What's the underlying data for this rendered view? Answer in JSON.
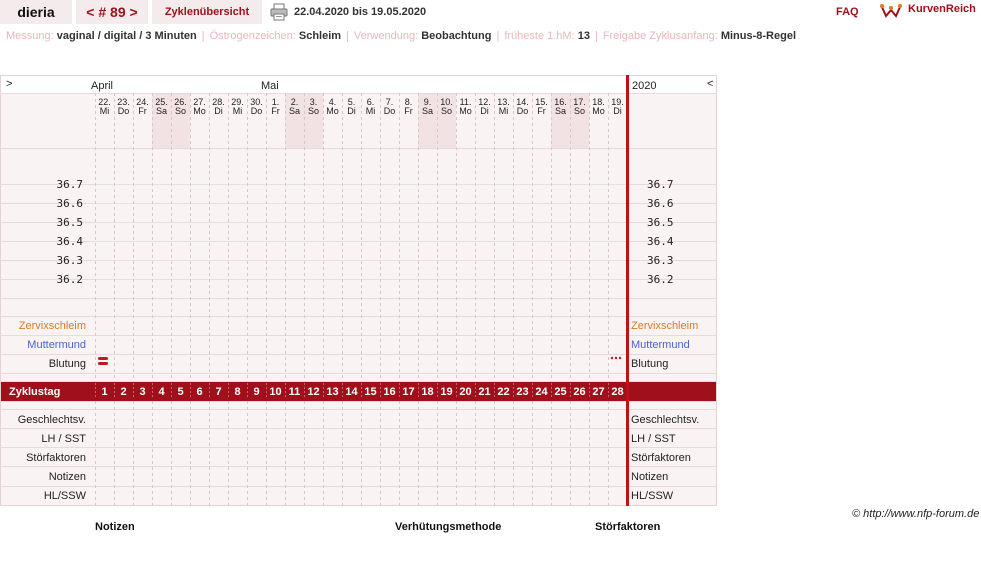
{
  "header": {
    "user": "dieria",
    "cycle_nav": "< # 89 >",
    "overview_label": "Zyklenübersicht",
    "date_range": "22.04.2020 bis 19.05.2020",
    "faq": "FAQ",
    "logo_text": "KurvenReich"
  },
  "info": [
    {
      "label": "Messung:",
      "value": "vaginal / digital / 3 Minuten"
    },
    {
      "label": "Östrogenzeichen:",
      "value": "Schleim"
    },
    {
      "label": "Verwendung:",
      "value": "Beobachtung"
    },
    {
      "label": "früheste 1.hM:",
      "value": "13"
    },
    {
      "label": "Freigabe Zyklusanfang:",
      "value": "Minus-8-Regel"
    }
  ],
  "chart": {
    "nav_prev": ">",
    "nav_next": "<",
    "months": [
      "April",
      "Mai"
    ],
    "year": "2020",
    "days": [
      {
        "d": "22.",
        "w": "Mi"
      },
      {
        "d": "23.",
        "w": "Do"
      },
      {
        "d": "24.",
        "w": "Fr"
      },
      {
        "d": "25.",
        "w": "Sa"
      },
      {
        "d": "26.",
        "w": "So"
      },
      {
        "d": "27.",
        "w": "Mo"
      },
      {
        "d": "28.",
        "w": "Di"
      },
      {
        "d": "29.",
        "w": "Mi"
      },
      {
        "d": "30.",
        "w": "Do"
      },
      {
        "d": "1.",
        "w": "Fr"
      },
      {
        "d": "2.",
        "w": "Sa"
      },
      {
        "d": "3.",
        "w": "So"
      },
      {
        "d": "4.",
        "w": "Mo"
      },
      {
        "d": "5.",
        "w": "Di"
      },
      {
        "d": "6.",
        "w": "Mi"
      },
      {
        "d": "7.",
        "w": "Do"
      },
      {
        "d": "8.",
        "w": "Fr"
      },
      {
        "d": "9.",
        "w": "Sa"
      },
      {
        "d": "10.",
        "w": "So"
      },
      {
        "d": "11.",
        "w": "Mo"
      },
      {
        "d": "12.",
        "w": "Di"
      },
      {
        "d": "13.",
        "w": "Mi"
      },
      {
        "d": "14.",
        "w": "Do"
      },
      {
        "d": "15.",
        "w": "Fr"
      },
      {
        "d": "16.",
        "w": "Sa"
      },
      {
        "d": "17.",
        "w": "So"
      },
      {
        "d": "18.",
        "w": "Mo"
      },
      {
        "d": "19.",
        "w": "Di"
      }
    ],
    "temps": [
      "36.7",
      "36.6",
      "36.5",
      "36.4",
      "36.3",
      "36.2"
    ],
    "rows": {
      "cervix": "Zervixschleim",
      "mouth": "Muttermund",
      "bleeding": "Blutung",
      "cycleday": "Zyklustag",
      "sex": "Geschlechtsv.",
      "lh": "LH / SST",
      "disturb": "Störfaktoren",
      "notes": "Notizen",
      "hlssw": "HL/SSW"
    },
    "cycle_days": [
      "1",
      "2",
      "3",
      "4",
      "5",
      "6",
      "7",
      "8",
      "9",
      "10",
      "11",
      "12",
      "13",
      "14",
      "15",
      "16",
      "17",
      "18",
      "19",
      "20",
      "21",
      "22",
      "23",
      "24",
      "25",
      "26",
      "27",
      "28"
    ],
    "colors": {
      "accent": "#a0101a",
      "cervix": "#e07a1c",
      "mouth": "#4a64c8",
      "weekend": "#f2e2e4",
      "bg": "#faf3f3"
    }
  },
  "copyright": "© http://www.nfp-forum.de",
  "footer": {
    "notes": "Notizen",
    "method": "Verhütungsmethode",
    "disturb": "Störfaktoren"
  }
}
